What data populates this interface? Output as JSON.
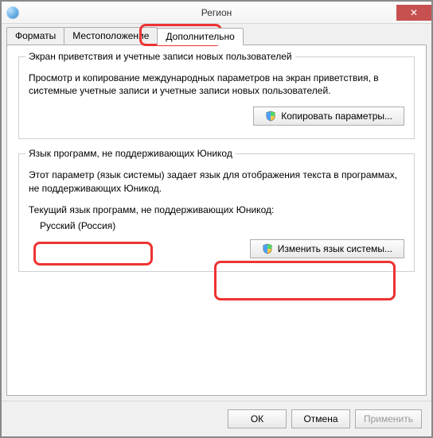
{
  "window": {
    "title": "Регион",
    "close_label": "✕"
  },
  "tabs": {
    "formats": "Форматы",
    "location": "Местоположение",
    "advanced": "Дополнительно"
  },
  "group1": {
    "legend": "Экран приветствия и учетные записи новых пользователей",
    "desc": "Просмотр и копирование международных параметров на экран приветствия, в системные учетные записи и учетные записи новых пользователей.",
    "button": "Копировать параметры..."
  },
  "group2": {
    "legend": "Язык программ, не поддерживающих Юникод",
    "desc": "Этот параметр (язык системы) задает язык для отображения текста в программах, не поддерживающих Юникод.",
    "current_label": "Текущий язык программ, не поддерживающих Юникод:",
    "current_value": "Русский (Россия)",
    "button": "Изменить язык системы..."
  },
  "footer": {
    "ok": "ОК",
    "cancel": "Отмена",
    "apply": "Применить"
  }
}
